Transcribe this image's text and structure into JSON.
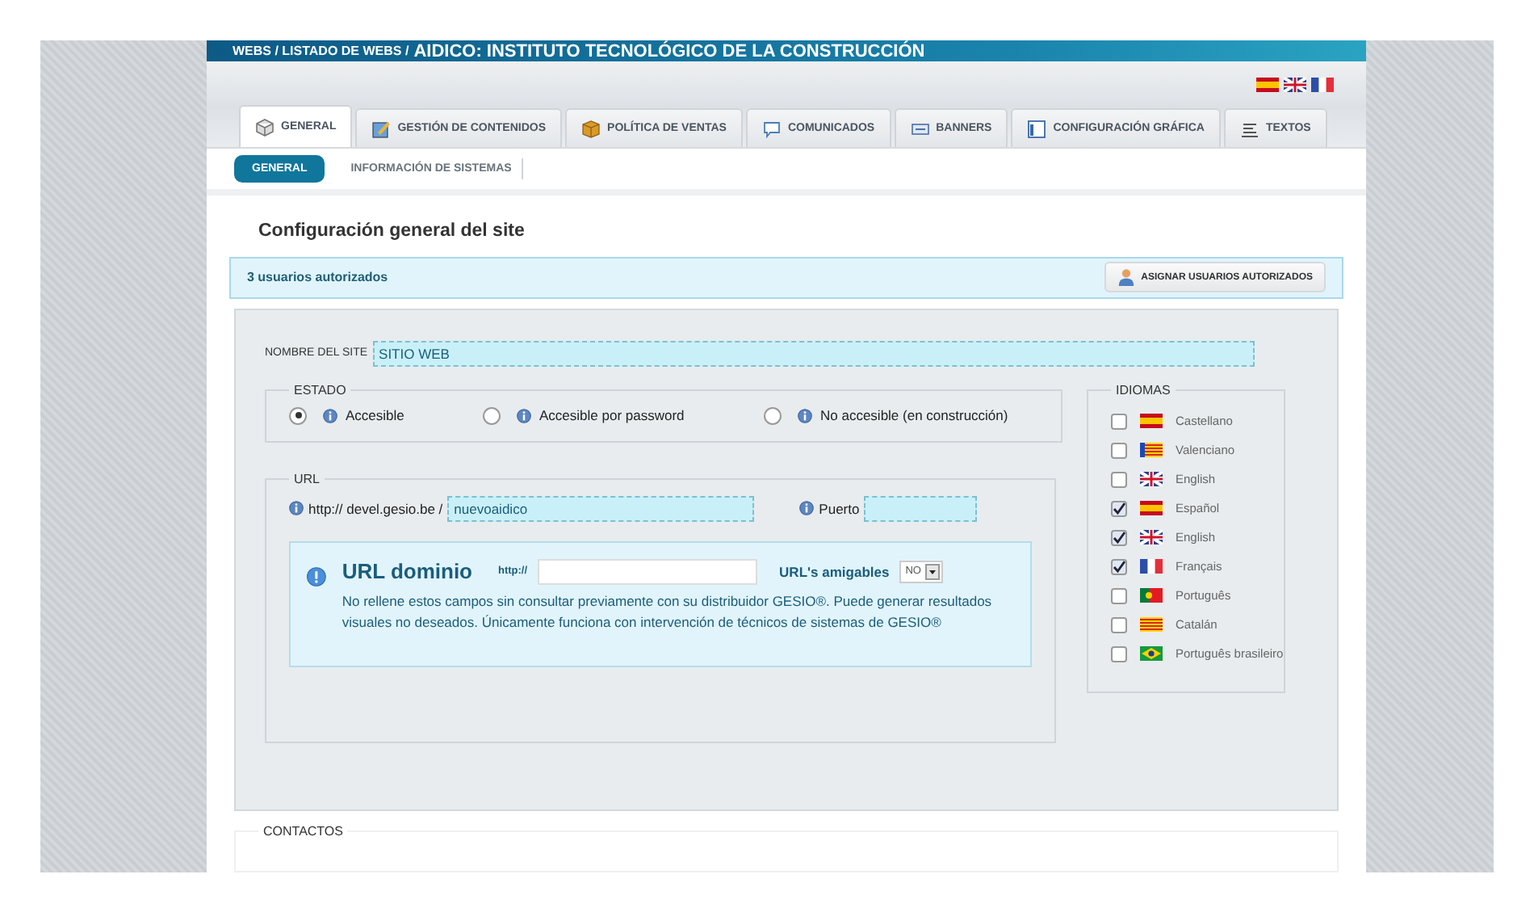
{
  "header": {
    "breadcrumb": "WEBS / LISTADO DE WEBS / ",
    "title": "AIDICO: INSTITUTO TECNOLÓGICO DE LA CONSTRUCCIÓN"
  },
  "top_flags": [
    {
      "kind": "es"
    },
    {
      "kind": "uk"
    },
    {
      "kind": "fr"
    }
  ],
  "tabs": [
    {
      "label": "GENERAL",
      "kind": "cube",
      "selected": true
    },
    {
      "label": "GESTIÓN DE CONTENIDOS",
      "kind": "edit",
      "selected": false
    },
    {
      "label": "POLÍTICA DE VENTAS",
      "kind": "box",
      "selected": false
    },
    {
      "label": "COMUNICADOS",
      "kind": "bubble",
      "selected": false
    },
    {
      "label": "BANNERS",
      "kind": "banner",
      "selected": false
    },
    {
      "label": "CONFIGURACIÓN GRÁFICA",
      "kind": "layout",
      "selected": false
    },
    {
      "label": "TEXTOS",
      "kind": "text",
      "selected": false
    }
  ],
  "subtabs": [
    {
      "label": "GENERAL",
      "selected": true
    },
    {
      "label": "INFORMACIÓN DE SISTEMAS",
      "selected": false
    }
  ],
  "page_title": "Configuración general del site",
  "users_bar": {
    "text": "3 usuarios autorizados",
    "button": "ASIGNAR USUARIOS AUTORIZADOS"
  },
  "site_name": {
    "label": "NOMBRE DEL SITE",
    "value": "SITIO WEB"
  },
  "estado": {
    "legend": "ESTADO",
    "options": [
      {
        "label": "Accesible",
        "selected": true
      },
      {
        "label": "Accesible por password",
        "selected": false
      },
      {
        "label": "No accesible (en construcción)",
        "selected": false
      }
    ]
  },
  "url": {
    "legend": "URL",
    "prefix": "http:// devel.gesio.be /",
    "value": "nuevoaidico",
    "port_label": "Puerto",
    "domain": {
      "title": "URL dominio",
      "http": "http://",
      "friendly_label": "URL's amigables",
      "friendly_value": "NO",
      "note": "No rellene estos campos sin consultar previamente con su distribuidor GESIO®. Puede generar resultados visuales no deseados. Únicamente funciona con intervención de técnicos de sistemas de GESIO®"
    }
  },
  "idiomas": {
    "legend": "IDIOMAS",
    "items": [
      {
        "label": "Castellano",
        "kind": "es",
        "checked": false
      },
      {
        "label": "Valenciano",
        "kind": "va",
        "checked": false
      },
      {
        "label": "English",
        "kind": "uk",
        "checked": false
      },
      {
        "label": "Español",
        "kind": "es",
        "checked": true
      },
      {
        "label": "English",
        "kind": "uk",
        "checked": true
      },
      {
        "label": "Français",
        "kind": "fr",
        "checked": true
      },
      {
        "label": "Português",
        "kind": "pt",
        "checked": false
      },
      {
        "label": "Catalán",
        "kind": "ca",
        "checked": false
      },
      {
        "label": "Português brasileiro",
        "kind": "br",
        "checked": false
      }
    ]
  },
  "contactos": {
    "legend": "CONTACTOS"
  }
}
